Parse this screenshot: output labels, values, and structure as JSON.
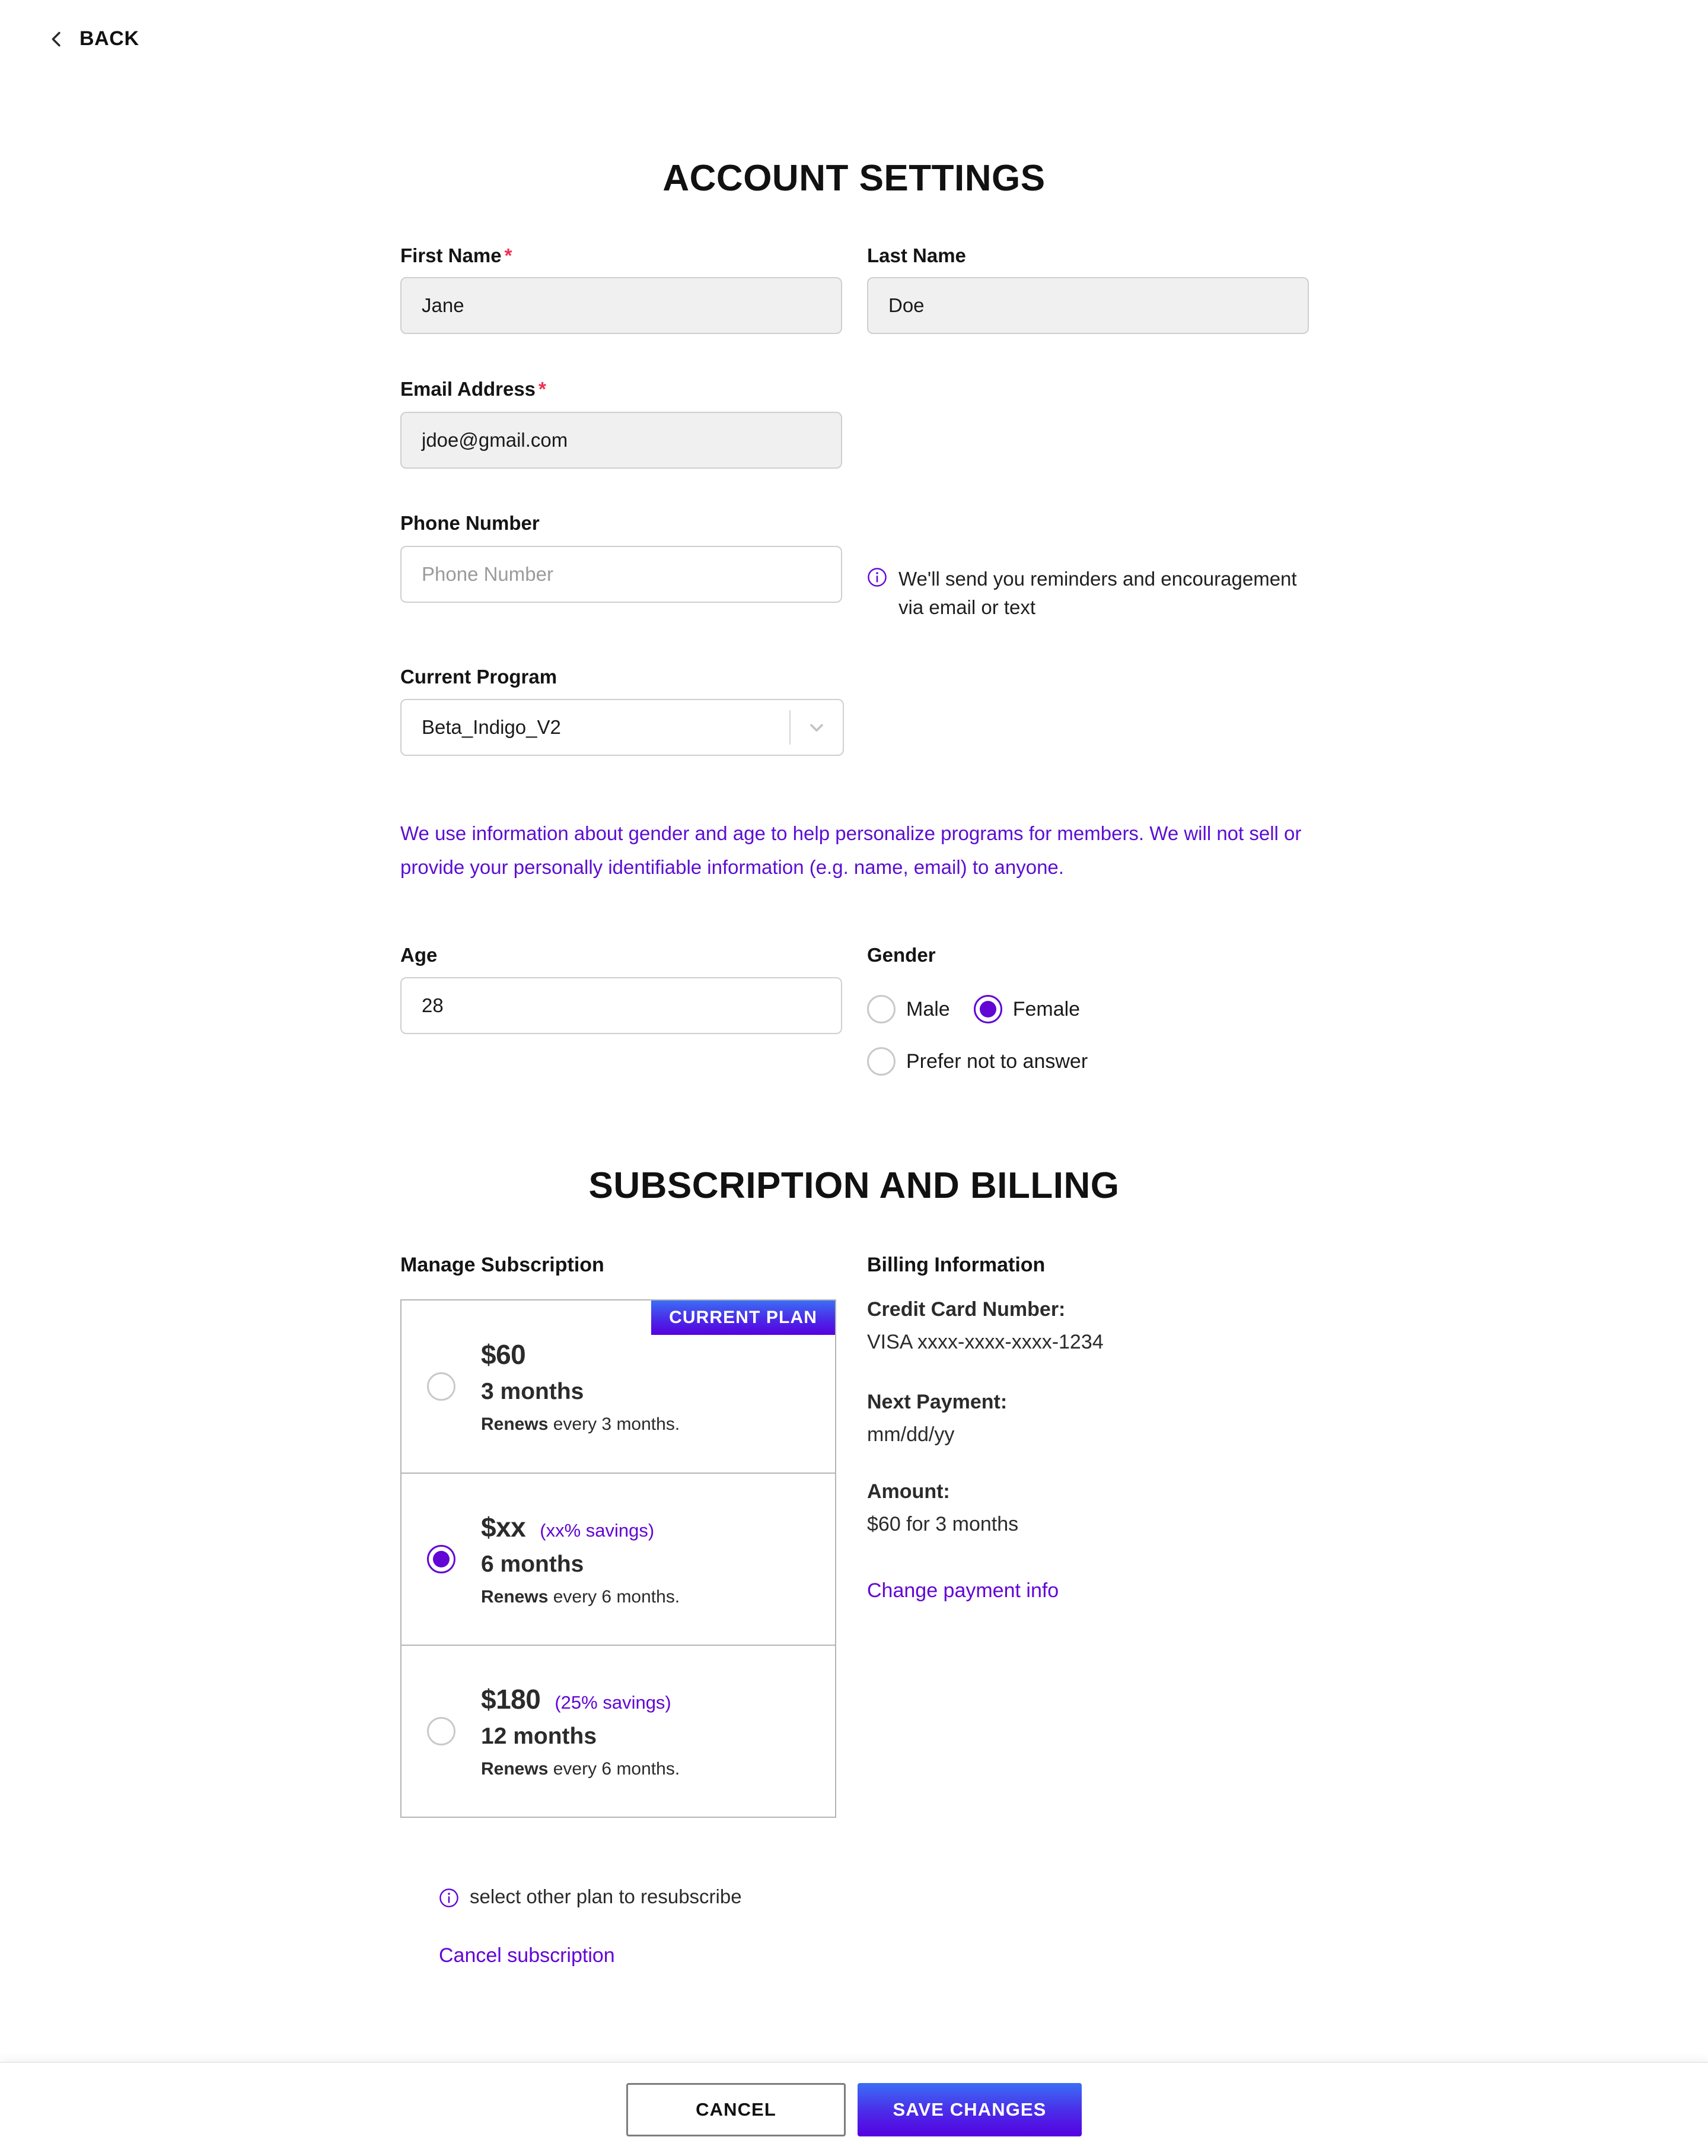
{
  "nav": {
    "back_label": "BACK",
    "back_icon": "chevron-left-icon"
  },
  "account": {
    "title": "ACCOUNT SETTINGS",
    "first_name": {
      "label": "First Name",
      "required_mark": "*",
      "value": "Jane"
    },
    "last_name": {
      "label": "Last Name",
      "value": "Doe"
    },
    "email": {
      "label": "Email Address",
      "required_mark": "*",
      "value": "jdoe@gmail.com"
    },
    "phone": {
      "label": "Phone Number",
      "value": "",
      "placeholder": "Phone Number",
      "hint": "We'll send you reminders and encouragement via email or text",
      "hint_icon": "info-circle-icon"
    },
    "program": {
      "label": "Current Program",
      "value": "Beta_Indigo_V2",
      "chevron_icon": "chevron-down-icon"
    },
    "privacy_note": "We use information about gender and age to help personalize programs for members. We will not sell or provide your personally identifiable information (e.g. name, email) to anyone.",
    "age": {
      "label": "Age",
      "value": "28"
    },
    "gender": {
      "label": "Gender",
      "options": [
        {
          "label": "Male",
          "selected": false
        },
        {
          "label": "Female",
          "selected": true
        },
        {
          "label": "Prefer not to answer",
          "selected": false
        }
      ]
    }
  },
  "subscription": {
    "title": "SUBSCRIPTION AND BILLING",
    "manage_heading": "Manage Subscription",
    "plans": [
      {
        "price": "$60",
        "savings": "",
        "duration": "3 months",
        "renews_bold": "Renews",
        "renews_rest": " every 3 months.",
        "selected": false,
        "badge": "CURRENT PLAN"
      },
      {
        "price": "$xx",
        "savings": "(xx% savings)",
        "duration": "6 months",
        "renews_bold": "Renews",
        "renews_rest": " every 6 months.",
        "selected": true,
        "badge": ""
      },
      {
        "price": "$180",
        "savings": "(25% savings)",
        "duration": "12 months",
        "renews_bold": "Renews",
        "renews_rest": " every 6 months.",
        "selected": false,
        "badge": ""
      }
    ],
    "resubscribe_hint": "select other plan to resubscribe",
    "resubscribe_icon": "info-circle-icon",
    "cancel_link": "Cancel subscription"
  },
  "billing": {
    "heading": "Billing Information",
    "card_key": "Credit Card Number:",
    "card_value": "VISA xxxx-xxxx-xxxx-1234",
    "next_key": "Next Payment:",
    "next_value": "mm/dd/yy",
    "amount_key": "Amount:",
    "amount_value": "$60 for 3 months",
    "change_link": "Change payment info"
  },
  "footer": {
    "cancel_label": "CANCEL",
    "save_label": "SAVE CHANGES"
  },
  "colors": {
    "accent_purple": "#6205d5",
    "brand_blue": "#3a6ef5",
    "required_red": "#ef3054",
    "field_fill": "#f0f0f0"
  }
}
